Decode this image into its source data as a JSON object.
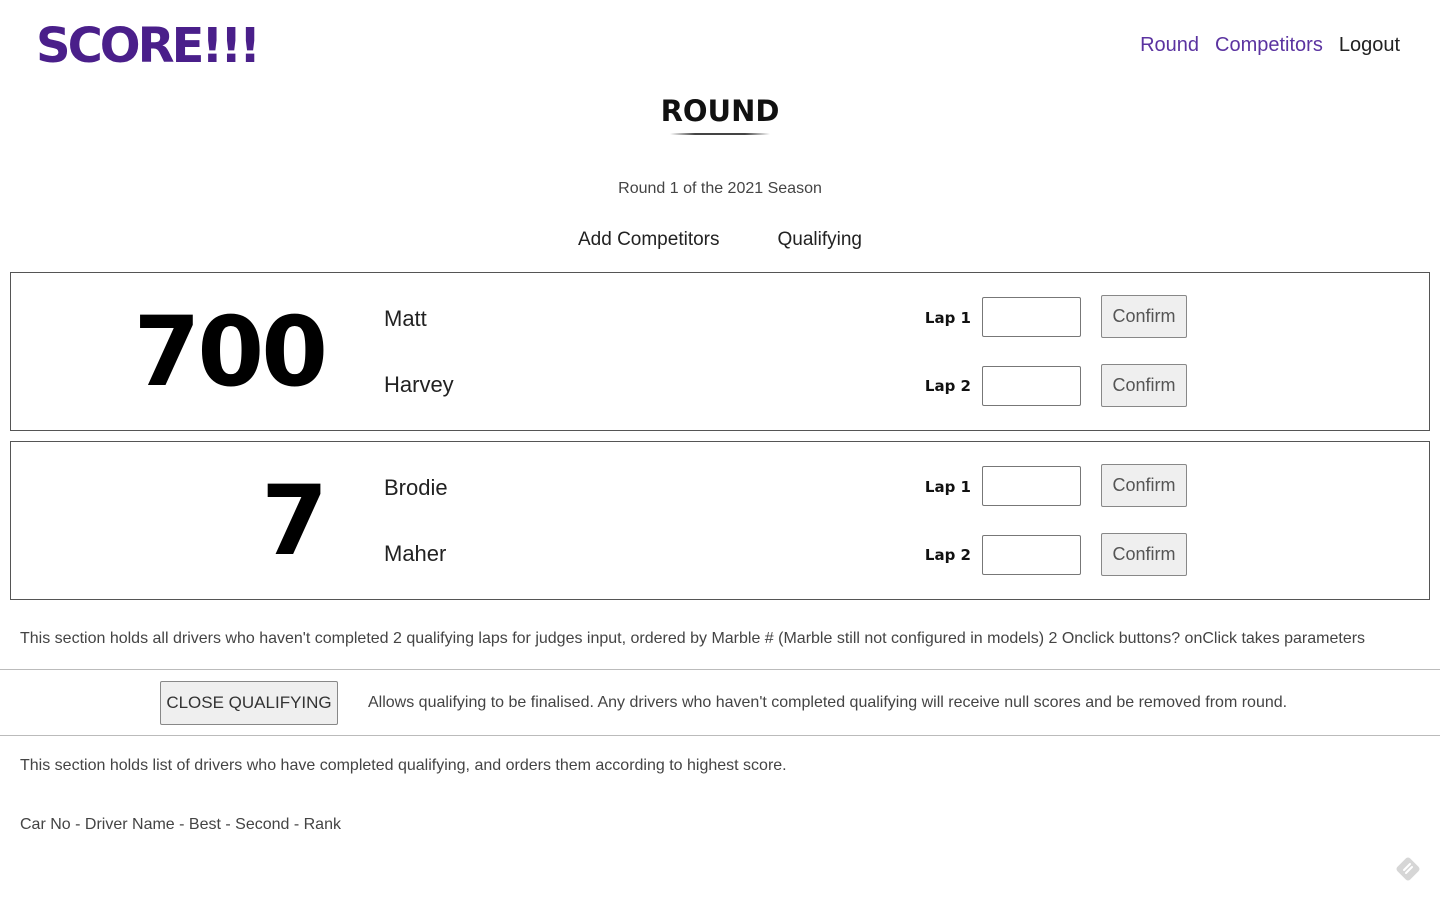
{
  "header": {
    "logo": "SCORE!!!",
    "nav": [
      {
        "label": "Round"
      },
      {
        "label": "Competitors"
      },
      {
        "label": "Logout"
      }
    ]
  },
  "page": {
    "title": "ROUND",
    "subtitle": "Round 1 of the 2021 Season",
    "subnav": [
      {
        "label": "Add Competitors"
      },
      {
        "label": "Qualifying"
      }
    ]
  },
  "pairs": [
    {
      "car_number": "700",
      "drivers": [
        "Matt",
        "Harvey"
      ],
      "laps": [
        {
          "label": "Lap 1",
          "value": "",
          "confirm_label": "Confirm"
        },
        {
          "label": "Lap 2",
          "value": "",
          "confirm_label": "Confirm"
        }
      ]
    },
    {
      "car_number": "7",
      "drivers": [
        "Brodie",
        "Maher"
      ],
      "laps": [
        {
          "label": "Lap 1",
          "value": "",
          "confirm_label": "Confirm"
        },
        {
          "label": "Lap 2",
          "value": "",
          "confirm_label": "Confirm"
        }
      ]
    }
  ],
  "notes": {
    "pending": "This section holds all drivers who haven't completed 2 qualifying laps for judges input, ordered by Marble # (Marble still not configured in models) 2 Onclick buttons? onClick takes parameters",
    "close_button": "CLOSE QUALIFYING",
    "close_description": "Allows qualifying to be finalised. Any drivers who haven't completed qualifying will receive null scores and be removed from round.",
    "completed": "This section holds list of drivers who have completed qualifying, and orders them according to highest score.",
    "columns": "Car No - Driver Name - Best - Second - Rank"
  },
  "icons": {
    "corner": "feedback-widget-icon"
  },
  "colors": {
    "brand": "#4a1f8a",
    "nav_link": "#5b33a0"
  }
}
